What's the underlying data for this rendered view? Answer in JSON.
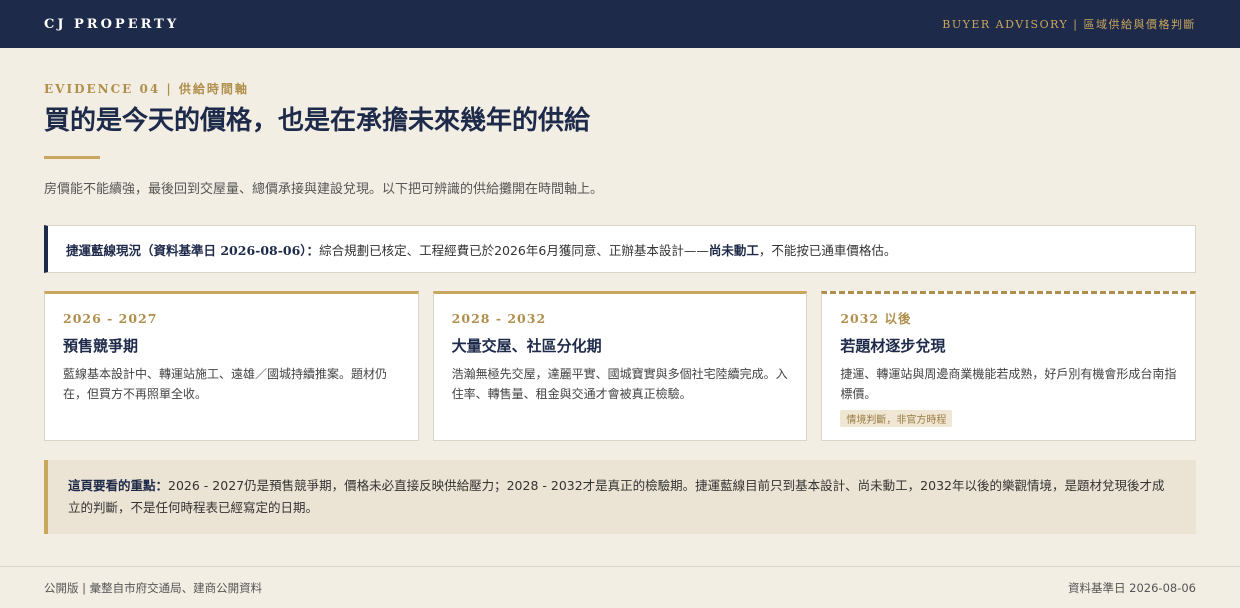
{
  "header": {
    "brand": "CJ PROPERTY",
    "nav_text": "BUYER ADVISORY | 區域供給與價格判斷"
  },
  "section": {
    "eyebrow": "EVIDENCE 04 | 供給時間軸",
    "title": "買的是今天的價格，也是在承擔未來幾年的供給",
    "intro": "房價能不能續強，最後回到交屋量、總價承接與建設兌現。以下把可辨識的供給攤開在時間軸上。"
  },
  "callout": {
    "lead": "捷運藍線現況（資料基準日 2026-08-06）：",
    "text_before": "綜合規劃已核定、工程經費已於2026年6月獲同意、正辦基本設計——",
    "emphasis": "尚未動工",
    "text_after": "，不能按已通車價格估。"
  },
  "timeline": [
    {
      "period": "2026 - 2027",
      "title": "預售競爭期",
      "body": "藍線基本設計中、轉運站施工、遠雄／國城持續推案。題材仍在，但買方不再照單全收。",
      "tag": ""
    },
    {
      "period": "2028 - 2032",
      "title": "大量交屋、社區分化期",
      "body": "浩瀚無極先交屋，達麗平實、國城寶實與多個社宅陸續完成。入住率、轉售量、租金與交通才會被真正檢驗。",
      "tag": ""
    },
    {
      "period": "2032 以後",
      "title": "若題材逐步兌現",
      "body": "捷運、轉運站與周邊商業機能若成熟，好戶別有機會形成台南指標價。",
      "tag": "情境判斷，非官方時程"
    }
  ],
  "summary": {
    "lead": "這頁要看的重點：",
    "text": "2026 - 2027仍是預售競爭期，價格未必直接反映供給壓力；2028 - 2032才是真正的檢驗期。捷運藍線目前只到基本設計、尚未動工，2032年以後的樂觀情境，是題材兌現後才成立的判斷，不是任何時程表已經寫定的日期。"
  },
  "footer": {
    "left": "公開版 | 彙整自市府交通局、建商公開資料",
    "right": "資料基準日 2026-08-06"
  },
  "colors": {
    "navy": "#1e2a4a",
    "gold": "#c9a75f",
    "background": "#f3eee4"
  }
}
